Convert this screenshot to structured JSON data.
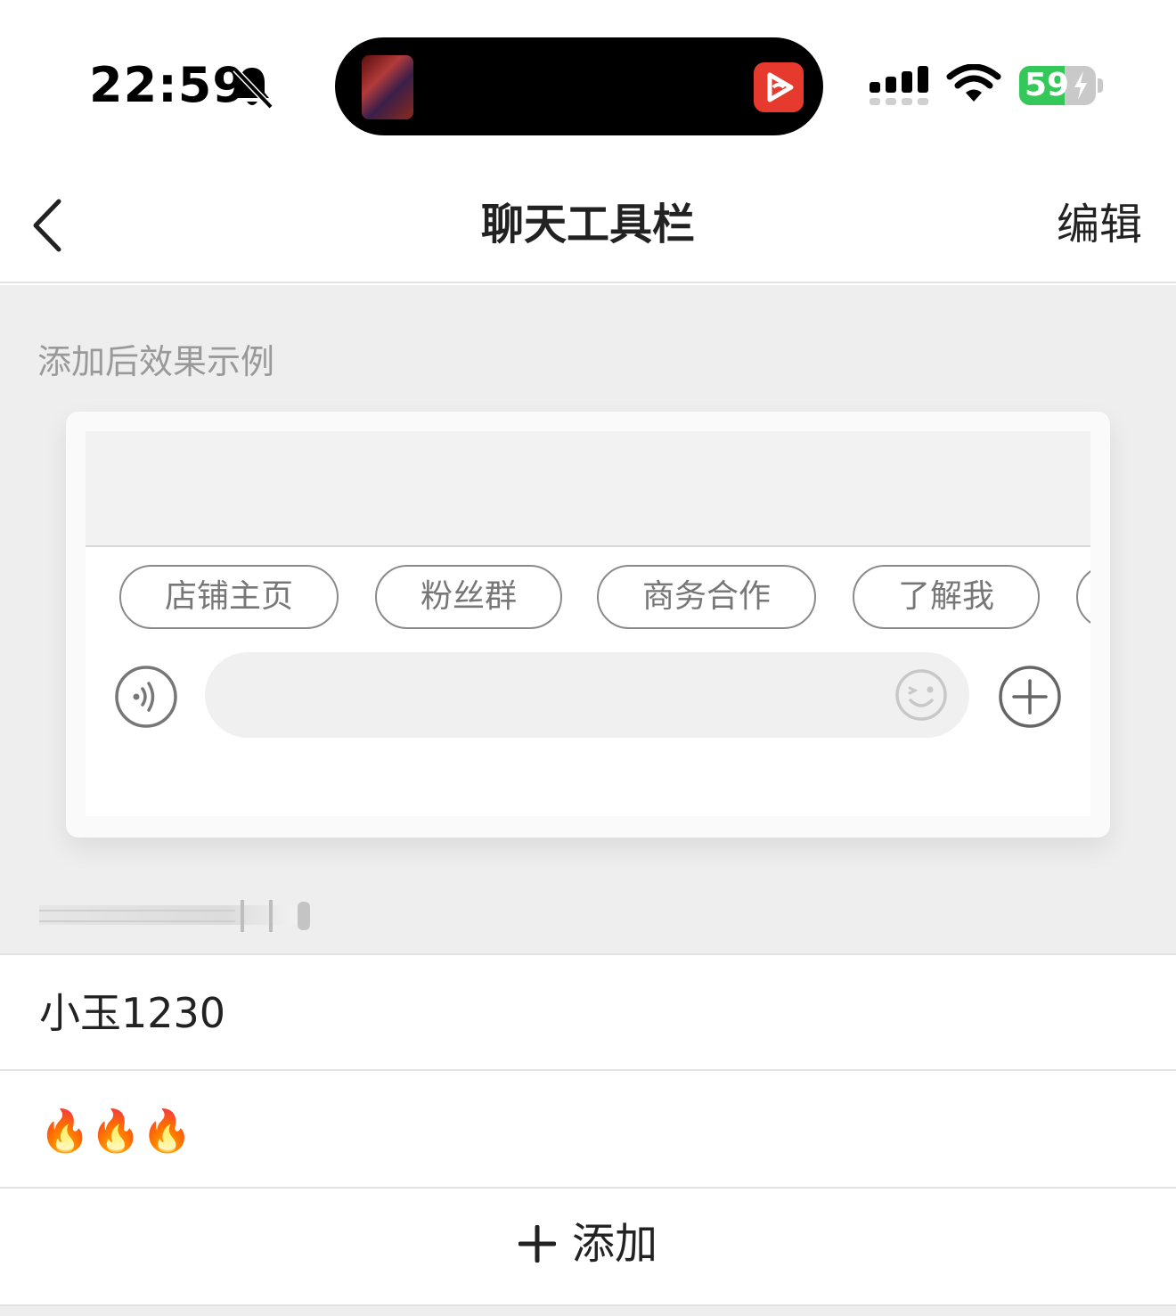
{
  "status_bar": {
    "time": "22:59",
    "battery_level": "59",
    "battery_percent": 59,
    "icons": [
      "bell-muted-icon",
      "cellular-signal-icon",
      "wifi-icon",
      "battery-charging-icon"
    ]
  },
  "nav": {
    "title": "聊天工具栏",
    "edit_label": "编辑",
    "back_icon": "chevron-left-icon"
  },
  "preview": {
    "label": "添加后效果示例",
    "chips": [
      "店铺主页",
      "粉丝群",
      "商务合作",
      "了解我"
    ],
    "icons": [
      "voice-icon",
      "emoji-icon",
      "plus-circle-icon"
    ]
  },
  "items": [
    {
      "label": "小玉1230"
    },
    {
      "label": "🔥🔥🔥",
      "icon": "fire-icon"
    }
  ],
  "add_button": {
    "label": "添加",
    "icon": "plus-icon"
  },
  "colors": {
    "background_gray": "#eeeeee",
    "battery_green": "#34c759",
    "app_red": "#e63a2e",
    "chip_border": "#8a8a8a",
    "muted_text": "#999999"
  }
}
